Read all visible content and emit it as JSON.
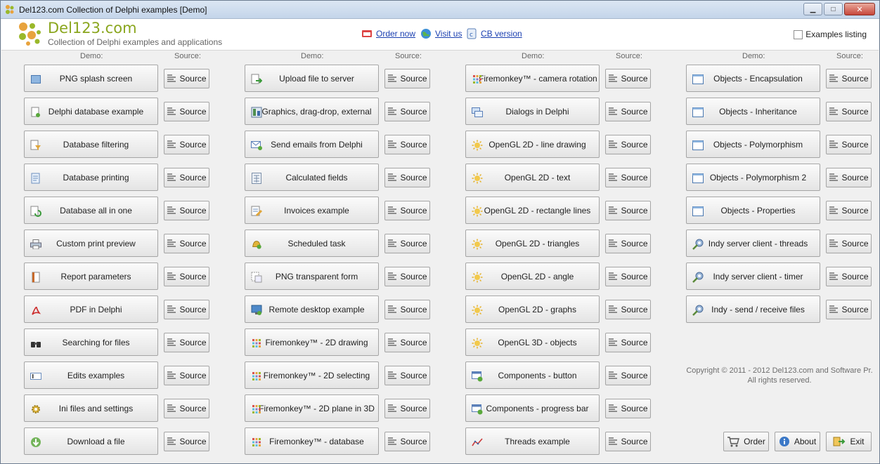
{
  "window": {
    "title": "Del123.com Collection of Delphi examples [Demo]",
    "controls": {
      "minimize": "▁",
      "maximize": "□",
      "close": "✕"
    }
  },
  "header": {
    "brand_title": "Del123.com",
    "brand_subtitle": "Collection of Delphi examples and applications",
    "links": [
      {
        "label": "Order now",
        "icon": "order-icon"
      },
      {
        "label": "Visit us",
        "icon": "globe-icon"
      },
      {
        "label": "CB version",
        "icon": "cb-icon"
      }
    ],
    "checkbox": {
      "label": "Examples listing",
      "checked": false
    }
  },
  "columns_header": {
    "demo": "Demo:",
    "source": "Source:"
  },
  "source_label": "Source",
  "columns": [
    {
      "items": [
        {
          "label": "PNG splash screen",
          "icon": "window-icon"
        },
        {
          "label": "Delphi database example",
          "icon": "database-doc-icon"
        },
        {
          "label": "Database filtering",
          "icon": "filter-doc-icon"
        },
        {
          "label": "Database printing",
          "icon": "print-doc-icon"
        },
        {
          "label": "Database all in one",
          "icon": "refresh-doc-icon"
        },
        {
          "label": "Custom print preview",
          "icon": "printer-icon"
        },
        {
          "label": "Report parameters",
          "icon": "report-icon"
        },
        {
          "label": "PDF in Delphi",
          "icon": "pdf-icon"
        },
        {
          "label": "Searching for files",
          "icon": "binoculars-icon"
        },
        {
          "label": "Edits examples",
          "icon": "edit-icon"
        },
        {
          "label": "Ini files and settings",
          "icon": "gear-icon"
        },
        {
          "label": "Download a file",
          "icon": "download-icon"
        }
      ]
    },
    {
      "items": [
        {
          "label": "Upload file to server",
          "icon": "upload-icon"
        },
        {
          "label": "Graphics, drag-drop, external",
          "icon": "graphics-icon"
        },
        {
          "label": "Send emails from Delphi",
          "icon": "email-icon"
        },
        {
          "label": "Calculated fields",
          "icon": "calculator-icon"
        },
        {
          "label": "Invoices example",
          "icon": "invoice-icon"
        },
        {
          "label": "Scheduled task",
          "icon": "bell-icon"
        },
        {
          "label": "PNG transparent form",
          "icon": "transparent-form-icon"
        },
        {
          "label": "Remote desktop example",
          "icon": "monitor-icon"
        },
        {
          "label": "Firemonkey™ - 2D drawing",
          "icon": "firemonkey-icon"
        },
        {
          "label": "Firemonkey™ - 2D selecting",
          "icon": "firemonkey-icon"
        },
        {
          "label": "Firemonkey™ - 2D plane in 3D",
          "icon": "firemonkey-icon"
        },
        {
          "label": "Firemonkey™ - database",
          "icon": "firemonkey-icon"
        }
      ]
    },
    {
      "items": [
        {
          "label": "Firemonkey™ - camera rotation",
          "icon": "firemonkey-icon"
        },
        {
          "label": "Dialogs in Delphi",
          "icon": "dialogs-icon"
        },
        {
          "label": "OpenGL 2D - line drawing",
          "icon": "sun-icon"
        },
        {
          "label": "OpenGL 2D - text",
          "icon": "sun-icon"
        },
        {
          "label": "OpenGL 2D - rectangle lines",
          "icon": "sun-icon"
        },
        {
          "label": "OpenGL 2D - triangles",
          "icon": "sun-icon"
        },
        {
          "label": "OpenGL 2D - angle",
          "icon": "sun-icon"
        },
        {
          "label": "OpenGL 2D - graphs",
          "icon": "sun-icon"
        },
        {
          "label": "OpenGL 3D - objects",
          "icon": "sun-icon"
        },
        {
          "label": "Components - button",
          "icon": "component-icon"
        },
        {
          "label": "Components - progress bar",
          "icon": "component-icon"
        },
        {
          "label": "Threads example",
          "icon": "chart-line-icon"
        }
      ]
    },
    {
      "items": [
        {
          "label": "Objects - Encapsulation",
          "icon": "window-frame-icon"
        },
        {
          "label": "Objects - Inheritance",
          "icon": "window-frame-icon"
        },
        {
          "label": "Objects - Polymorphism",
          "icon": "window-frame-icon"
        },
        {
          "label": "Objects - Polymorphism 2",
          "icon": "window-frame-icon"
        },
        {
          "label": "Objects - Properties",
          "icon": "window-frame-icon"
        },
        {
          "label": "Indy server client - threads",
          "icon": "network-icon"
        },
        {
          "label": "Indy server client - timer",
          "icon": "network-icon"
        },
        {
          "label": "Indy - send / receive files",
          "icon": "network-icon"
        }
      ]
    }
  ],
  "footer": {
    "copyright_line1": "Copyright © 2011 - 2012 Del123.com and Software Pr.",
    "copyright_line2": "All rights reserved.",
    "buttons": [
      {
        "label": "Order",
        "icon": "cart-icon"
      },
      {
        "label": "About",
        "icon": "info-icon"
      },
      {
        "label": "Exit",
        "icon": "exit-icon"
      }
    ]
  },
  "colors": {
    "brand": "#8aa61e",
    "link": "#1a3fb0",
    "title_bar": "#c4d5ea"
  }
}
